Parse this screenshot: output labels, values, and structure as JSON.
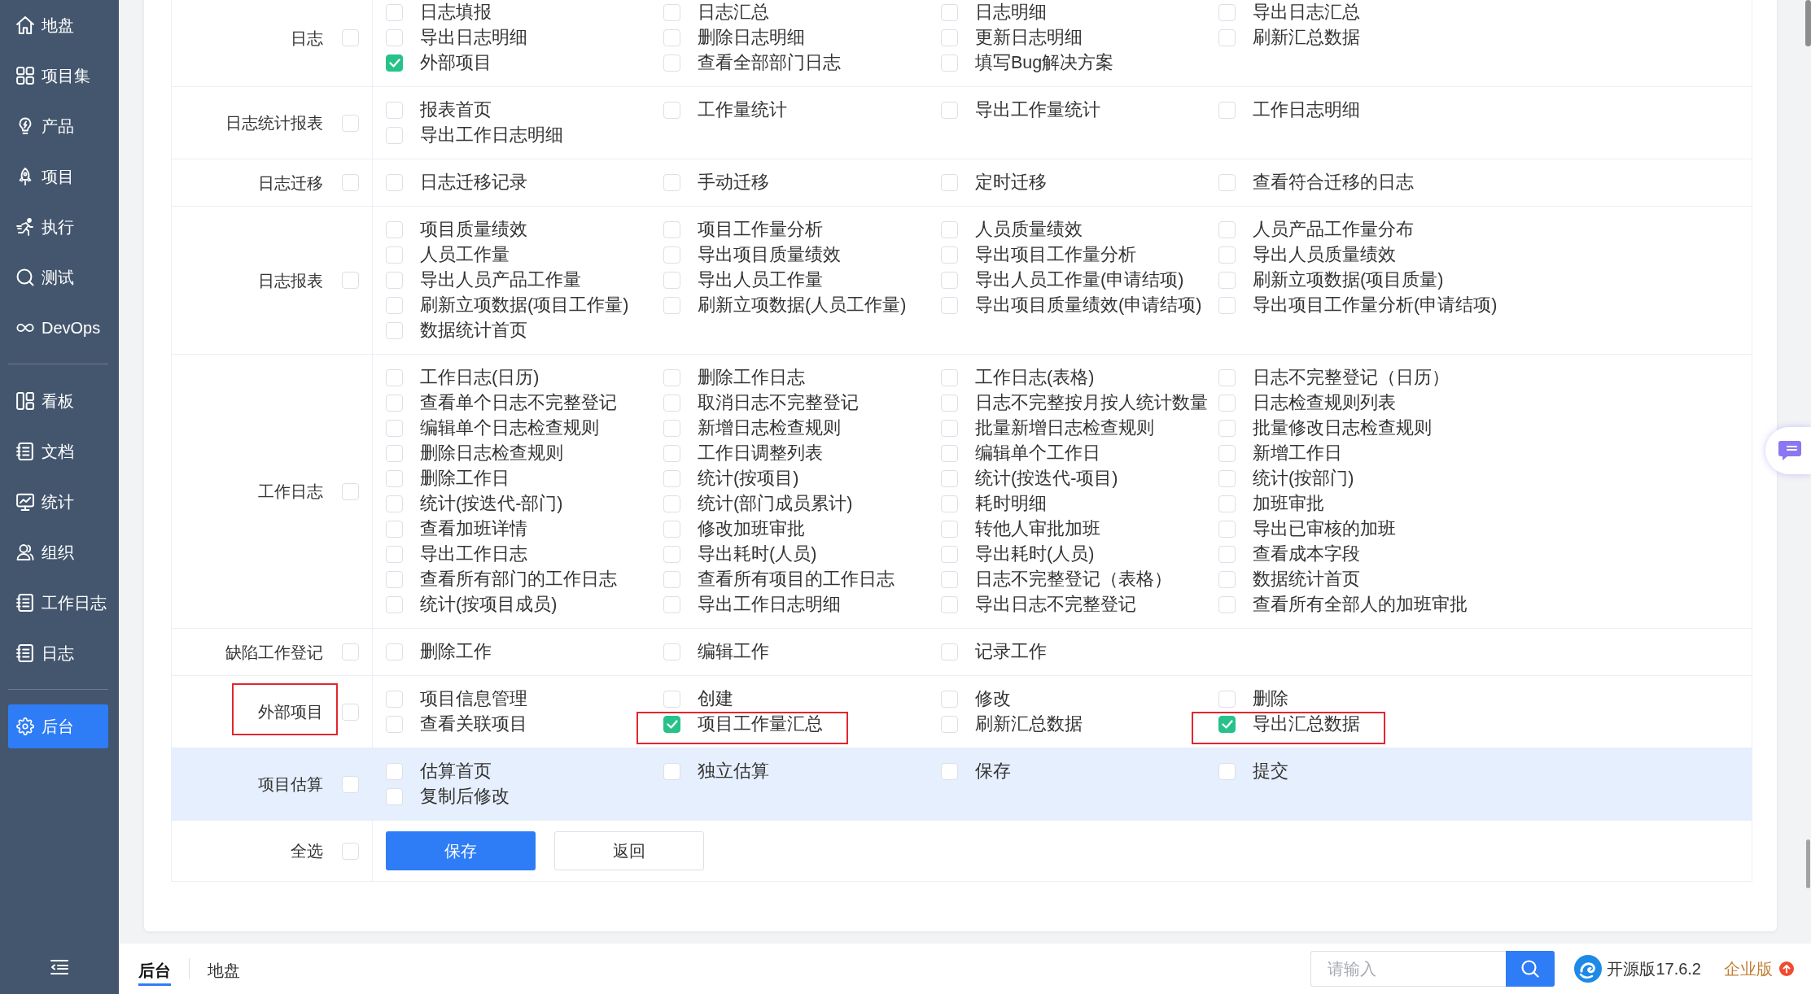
{
  "sidebar": {
    "groups": [
      {
        "items": [
          {
            "label": "地盘",
            "selected": false
          },
          {
            "label": "项目集",
            "selected": false
          },
          {
            "label": "产品",
            "selected": false
          },
          {
            "label": "项目",
            "selected": false
          },
          {
            "label": "执行",
            "selected": false
          },
          {
            "label": "测试",
            "selected": false
          },
          {
            "label": "DevOps",
            "selected": false
          }
        ]
      },
      {
        "items": [
          {
            "label": "看板",
            "selected": false
          },
          {
            "label": "文档",
            "selected": false
          },
          {
            "label": "统计",
            "selected": false
          },
          {
            "label": "组织",
            "selected": false
          },
          {
            "label": "工作日志",
            "selected": false
          },
          {
            "label": "日志",
            "selected": false
          }
        ]
      },
      {
        "items": [
          {
            "label": "后台",
            "selected": true
          }
        ]
      }
    ]
  },
  "permissions": {
    "sections": [
      {
        "label": "日志",
        "checked": false,
        "highlighted": false,
        "outlined": false,
        "items": [
          {
            "label": "日志填报",
            "checked": false,
            "outlined": false
          },
          {
            "label": "日志汇总",
            "checked": false,
            "outlined": false
          },
          {
            "label": "日志明细",
            "checked": false,
            "outlined": false
          },
          {
            "label": "导出日志汇总",
            "checked": false,
            "outlined": false
          },
          {
            "label": "导出日志明细",
            "checked": false,
            "outlined": false
          },
          {
            "label": "删除日志明细",
            "checked": false,
            "outlined": false
          },
          {
            "label": "更新日志明细",
            "checked": false,
            "outlined": false
          },
          {
            "label": "刷新汇总数据",
            "checked": false,
            "outlined": false
          },
          {
            "label": "外部项目",
            "checked": true,
            "outlined": false
          },
          {
            "label": "查看全部部门日志",
            "checked": false,
            "outlined": false
          },
          {
            "label": "填写Bug解决方案",
            "checked": false,
            "outlined": false
          }
        ]
      },
      {
        "label": "日志统计报表",
        "checked": false,
        "highlighted": false,
        "outlined": false,
        "items": [
          {
            "label": "报表首页",
            "checked": false,
            "outlined": false
          },
          {
            "label": "工作量统计",
            "checked": false,
            "outlined": false
          },
          {
            "label": "导出工作量统计",
            "checked": false,
            "outlined": false
          },
          {
            "label": "工作日志明细",
            "checked": false,
            "outlined": false
          },
          {
            "label": "导出工作日志明细",
            "checked": false,
            "outlined": false
          }
        ]
      },
      {
        "label": "日志迁移",
        "checked": false,
        "highlighted": false,
        "outlined": false,
        "items": [
          {
            "label": "日志迁移记录",
            "checked": false,
            "outlined": false
          },
          {
            "label": "手动迁移",
            "checked": false,
            "outlined": false
          },
          {
            "label": "定时迁移",
            "checked": false,
            "outlined": false
          },
          {
            "label": "查看符合迁移的日志",
            "checked": false,
            "outlined": false
          }
        ]
      },
      {
        "label": "日志报表",
        "checked": false,
        "highlighted": false,
        "outlined": false,
        "items": [
          {
            "label": "项目质量绩效",
            "checked": false,
            "outlined": false
          },
          {
            "label": "项目工作量分析",
            "checked": false,
            "outlined": false
          },
          {
            "label": "人员质量绩效",
            "checked": false,
            "outlined": false
          },
          {
            "label": "人员产品工作量分布",
            "checked": false,
            "outlined": false
          },
          {
            "label": "人员工作量",
            "checked": false,
            "outlined": false
          },
          {
            "label": "导出项目质量绩效",
            "checked": false,
            "outlined": false
          },
          {
            "label": "导出项目工作量分析",
            "checked": false,
            "outlined": false
          },
          {
            "label": "导出人员质量绩效",
            "checked": false,
            "outlined": false
          },
          {
            "label": "导出人员产品工作量",
            "checked": false,
            "outlined": false
          },
          {
            "label": "导出人员工作量",
            "checked": false,
            "outlined": false
          },
          {
            "label": "导出人员工作量(申请结项)",
            "checked": false,
            "outlined": false
          },
          {
            "label": "刷新立项数据(项目质量)",
            "checked": false,
            "outlined": false
          },
          {
            "label": "刷新立项数据(项目工作量)",
            "checked": false,
            "outlined": false
          },
          {
            "label": "刷新立项数据(人员工作量)",
            "checked": false,
            "outlined": false
          },
          {
            "label": "导出项目质量绩效(申请结项)",
            "checked": false,
            "outlined": false
          },
          {
            "label": "导出项目工作量分析(申请结项)",
            "checked": false,
            "outlined": false
          },
          {
            "label": "数据统计首页",
            "checked": false,
            "outlined": false
          }
        ]
      },
      {
        "label": "工作日志",
        "checked": false,
        "highlighted": false,
        "outlined": false,
        "items": [
          {
            "label": "工作日志(日历)",
            "checked": false,
            "outlined": false
          },
          {
            "label": "删除工作日志",
            "checked": false,
            "outlined": false
          },
          {
            "label": "工作日志(表格)",
            "checked": false,
            "outlined": false
          },
          {
            "label": "日志不完整登记（日历）",
            "checked": false,
            "outlined": false
          },
          {
            "label": "查看单个日志不完整登记",
            "checked": false,
            "outlined": false
          },
          {
            "label": "取消日志不完整登记",
            "checked": false,
            "outlined": false
          },
          {
            "label": "日志不完整按月按人统计数量",
            "checked": false,
            "outlined": false
          },
          {
            "label": "日志检查规则列表",
            "checked": false,
            "outlined": false
          },
          {
            "label": "编辑单个日志检查规则",
            "checked": false,
            "outlined": false
          },
          {
            "label": "新增日志检查规则",
            "checked": false,
            "outlined": false
          },
          {
            "label": "批量新增日志检查规则",
            "checked": false,
            "outlined": false
          },
          {
            "label": "批量修改日志检查规则",
            "checked": false,
            "outlined": false
          },
          {
            "label": "删除日志检查规则",
            "checked": false,
            "outlined": false
          },
          {
            "label": "工作日调整列表",
            "checked": false,
            "outlined": false
          },
          {
            "label": "编辑单个工作日",
            "checked": false,
            "outlined": false
          },
          {
            "label": "新增工作日",
            "checked": false,
            "outlined": false
          },
          {
            "label": "删除工作日",
            "checked": false,
            "outlined": false
          },
          {
            "label": "统计(按项目)",
            "checked": false,
            "outlined": false
          },
          {
            "label": "统计(按迭代-项目)",
            "checked": false,
            "outlined": false
          },
          {
            "label": "统计(按部门)",
            "checked": false,
            "outlined": false
          },
          {
            "label": "统计(按迭代-部门)",
            "checked": false,
            "outlined": false
          },
          {
            "label": "统计(部门成员累计)",
            "checked": false,
            "outlined": false
          },
          {
            "label": "耗时明细",
            "checked": false,
            "outlined": false
          },
          {
            "label": "加班审批",
            "checked": false,
            "outlined": false
          },
          {
            "label": "查看加班详情",
            "checked": false,
            "outlined": false
          },
          {
            "label": "修改加班审批",
            "checked": false,
            "outlined": false
          },
          {
            "label": "转他人审批加班",
            "checked": false,
            "outlined": false
          },
          {
            "label": "导出已审核的加班",
            "checked": false,
            "outlined": false
          },
          {
            "label": "导出工作日志",
            "checked": false,
            "outlined": false
          },
          {
            "label": "导出耗时(人员)",
            "checked": false,
            "outlined": false
          },
          {
            "label": "导出耗时(人员)",
            "checked": false,
            "outlined": false
          },
          {
            "label": "查看成本字段",
            "checked": false,
            "outlined": false
          },
          {
            "label": "查看所有部门的工作日志",
            "checked": false,
            "outlined": false
          },
          {
            "label": "查看所有项目的工作日志",
            "checked": false,
            "outlined": false
          },
          {
            "label": "日志不完整登记（表格）",
            "checked": false,
            "outlined": false
          },
          {
            "label": "数据统计首页",
            "checked": false,
            "outlined": false
          },
          {
            "label": "统计(按项目成员)",
            "checked": false,
            "outlined": false
          },
          {
            "label": "导出工作日志明细",
            "checked": false,
            "outlined": false
          },
          {
            "label": "导出日志不完整登记",
            "checked": false,
            "outlined": false
          },
          {
            "label": "查看所有全部人的加班审批",
            "checked": false,
            "outlined": false
          }
        ]
      },
      {
        "label": "缺陷工作登记",
        "checked": false,
        "highlighted": false,
        "outlined": false,
        "items": [
          {
            "label": "删除工作",
            "checked": false,
            "outlined": false
          },
          {
            "label": "编辑工作",
            "checked": false,
            "outlined": false
          },
          {
            "label": "记录工作",
            "checked": false,
            "outlined": false
          }
        ]
      },
      {
        "label": "外部项目",
        "checked": false,
        "highlighted": false,
        "outlined": true,
        "items": [
          {
            "label": "项目信息管理",
            "checked": false,
            "outlined": false
          },
          {
            "label": "创建",
            "checked": false,
            "outlined": false
          },
          {
            "label": "修改",
            "checked": false,
            "outlined": false
          },
          {
            "label": "删除",
            "checked": false,
            "outlined": false
          },
          {
            "label": "查看关联项目",
            "checked": false,
            "outlined": false
          },
          {
            "label": "项目工作量汇总",
            "checked": true,
            "outlined": true
          },
          {
            "label": "刷新汇总数据",
            "checked": false,
            "outlined": false
          },
          {
            "label": "导出汇总数据",
            "checked": true,
            "outlined": true
          }
        ]
      },
      {
        "label": "项目估算",
        "checked": false,
        "highlighted": true,
        "outlined": false,
        "items": [
          {
            "label": "估算首页",
            "checked": false,
            "outlined": false
          },
          {
            "label": "独立估算",
            "checked": false,
            "outlined": false
          },
          {
            "label": "保存",
            "checked": false,
            "outlined": false
          },
          {
            "label": "提交",
            "checked": false,
            "outlined": false
          },
          {
            "label": "复制后修改",
            "checked": false,
            "outlined": false
          }
        ]
      }
    ],
    "select_all": {
      "label": "全选",
      "checked": false
    },
    "buttons": [
      {
        "label": "保存",
        "kind": "primary"
      },
      {
        "label": "返回",
        "kind": "default"
      }
    ]
  },
  "bottom_bar": {
    "tabs": [
      {
        "label": "后台",
        "selected": true
      },
      {
        "label": "地盘",
        "selected": false
      }
    ],
    "search": {
      "placeholder": "请输入"
    },
    "version": "开源版17.6.2",
    "edition": "企业版"
  }
}
